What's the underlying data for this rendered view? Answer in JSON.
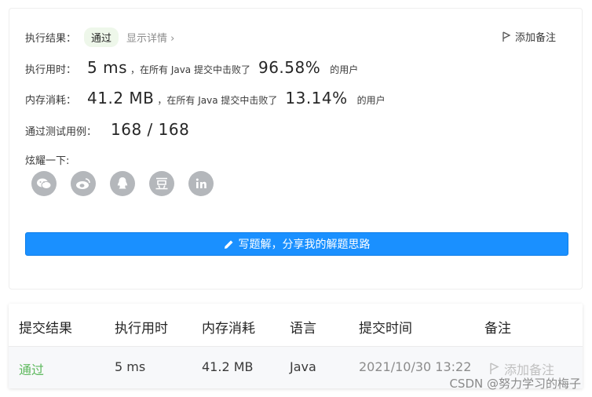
{
  "result": {
    "label": "执行结果：",
    "status": "通过",
    "details_link": "显示详情 ›",
    "add_note": "添加备注"
  },
  "runtime": {
    "label": "执行用时：",
    "value": "5 ms",
    "mid_text": "，在所有 Java 提交中击败了",
    "percent": "96.58%",
    "suffix": "的用户"
  },
  "memory": {
    "label": "内存消耗：",
    "value": "41.2 MB",
    "mid_text": "，在所有 Java 提交中击败了",
    "percent": "13.14%",
    "suffix": "的用户"
  },
  "testcases": {
    "label": "通过测试用例：",
    "value": "168 / 168"
  },
  "share": {
    "label": "炫耀一下:",
    "icons": [
      "wechat-icon",
      "weibo-icon",
      "qq-icon",
      "douban-icon",
      "linkedin-icon"
    ]
  },
  "write_button": {
    "label": "写题解，分享我的解题思路"
  },
  "table": {
    "headers": [
      "提交结果",
      "执行用时",
      "内存消耗",
      "语言",
      "提交时间",
      "备注"
    ],
    "row": {
      "result": "通过",
      "runtime": "5 ms",
      "memory": "41.2 MB",
      "language": "Java",
      "time": "2021/10/30 13:22",
      "note": "添加备注"
    }
  },
  "watermark": "CSDN @努力学习的梅子",
  "colors": {
    "primary": "#1a90ff",
    "success": "#5cb85c",
    "icon_gray": "#b4b7bb"
  }
}
